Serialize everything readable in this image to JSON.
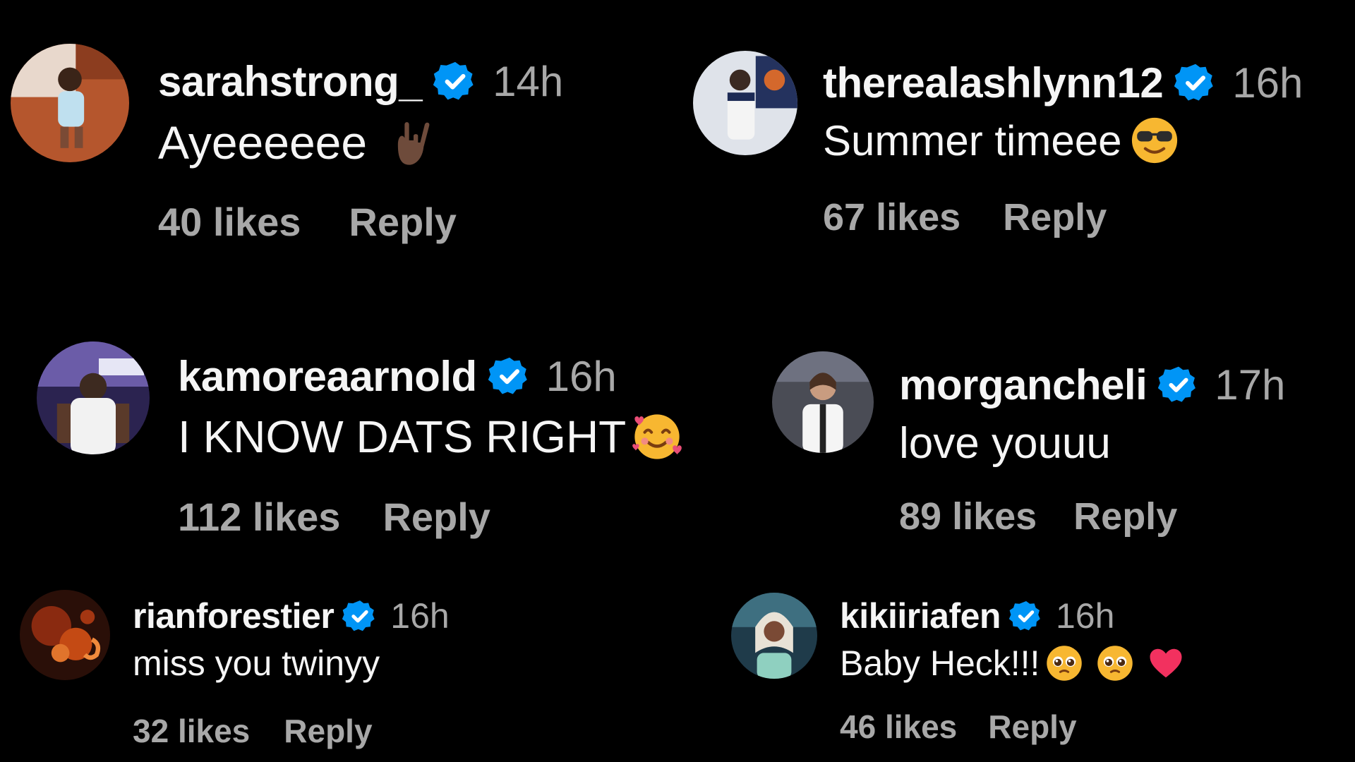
{
  "accent_color": "#0095f6",
  "comments": [
    {
      "username": "sarahstrong_",
      "verified": true,
      "time": "14h",
      "text": "Ayeeeeee",
      "emoji": [
        "ily-hand-emoji"
      ],
      "likes": "40 likes",
      "reply_label": "Reply"
    },
    {
      "username": "therealashlynn12",
      "verified": true,
      "time": "16h",
      "text": "Summer timeee",
      "emoji": [
        "sunglasses-face-emoji"
      ],
      "likes": "67 likes",
      "reply_label": "Reply"
    },
    {
      "username": "kamoreaarnold",
      "verified": true,
      "time": "16h",
      "text": "I KNOW DATS RIGHT",
      "emoji": [
        "smiling-face-with-hearts-emoji"
      ],
      "likes": "112 likes",
      "reply_label": "Reply"
    },
    {
      "username": "morgancheli",
      "verified": true,
      "time": "17h",
      "text": "love youuu",
      "emoji": [],
      "likes": "89 likes",
      "reply_label": "Reply"
    },
    {
      "username": "rianforestier",
      "verified": true,
      "time": "16h",
      "text": "miss you twinyy",
      "emoji": [],
      "likes": "32 likes",
      "reply_label": "Reply"
    },
    {
      "username": "kikiiriafen",
      "verified": true,
      "time": "16h",
      "text": "Baby Heck!!!",
      "emoji": [
        "pleading-face-emoji",
        "pleading-face-emoji",
        "red-heart-emoji"
      ],
      "likes": "46 likes",
      "reply_label": "Reply"
    }
  ]
}
